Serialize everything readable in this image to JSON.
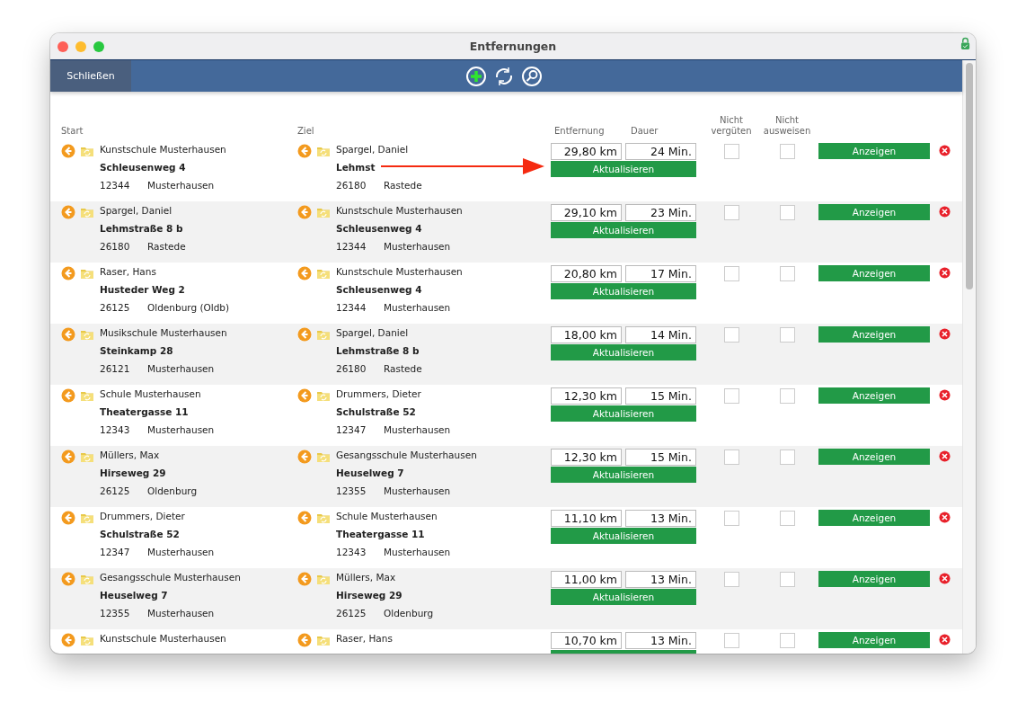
{
  "window": {
    "title": "Entfernungen"
  },
  "toolbar": {
    "close_label": "Schließen"
  },
  "columns": {
    "start": "Start",
    "ziel": "Ziel",
    "distance": "Entfernung",
    "duration": "Dauer",
    "not_paid": "Nicht vergüten",
    "not_shown": "Nicht ausweisen"
  },
  "rows": [
    {
      "start": {
        "name": "Kunstschule Musterhausen",
        "street": "Schleusenweg 4",
        "zip": "12344",
        "city": "Musterhausen"
      },
      "ziel": {
        "name": "Spargel, Daniel",
        "street": "Lehmst",
        "zip": "26180",
        "city": "Rastede"
      },
      "distance": "29,80 km",
      "duration": "24 Min.",
      "update": "Aktualisieren",
      "not_paid": false,
      "not_shown": false,
      "show": "Anzeigen",
      "annotated": true
    },
    {
      "start": {
        "name": "Spargel, Daniel",
        "street": "Lehmstraße 8 b",
        "zip": "26180",
        "city": "Rastede"
      },
      "ziel": {
        "name": "Kunstschule Musterhausen",
        "street": "Schleusenweg 4",
        "zip": "12344",
        "city": "Musterhausen"
      },
      "distance": "29,10 km",
      "duration": "23 Min.",
      "update": "Aktualisieren",
      "not_paid": false,
      "not_shown": false,
      "show": "Anzeigen",
      "annotated": false
    },
    {
      "start": {
        "name": "Raser, Hans",
        "street": "Husteder Weg 2",
        "zip": "26125",
        "city": "Oldenburg (Oldb)"
      },
      "ziel": {
        "name": "Kunstschule Musterhausen",
        "street": "Schleusenweg 4",
        "zip": "12344",
        "city": "Musterhausen"
      },
      "distance": "20,80 km",
      "duration": "17 Min.",
      "update": "Aktualisieren",
      "not_paid": false,
      "not_shown": false,
      "show": "Anzeigen",
      "annotated": false
    },
    {
      "start": {
        "name": "Musikschule Musterhausen",
        "street": "Steinkamp 28",
        "zip": "26121",
        "city": "Musterhausen"
      },
      "ziel": {
        "name": "Spargel, Daniel",
        "street": "Lehmstraße 8 b",
        "zip": "26180",
        "city": "Rastede"
      },
      "distance": "18,00 km",
      "duration": "14 Min.",
      "update": "Aktualisieren",
      "not_paid": false,
      "not_shown": false,
      "show": "Anzeigen",
      "annotated": false
    },
    {
      "start": {
        "name": "Schule Musterhausen",
        "street": "Theatergasse 11",
        "zip": "12343",
        "city": "Musterhausen"
      },
      "ziel": {
        "name": "Drummers, Dieter",
        "street": "Schulstraße 52",
        "zip": "12347",
        "city": "Musterhausen"
      },
      "distance": "12,30 km",
      "duration": "15 Min.",
      "update": "Aktualisieren",
      "not_paid": false,
      "not_shown": false,
      "show": "Anzeigen",
      "annotated": false
    },
    {
      "start": {
        "name": "Müllers, Max",
        "street": "Hirseweg 29",
        "zip": "26125",
        "city": "Oldenburg"
      },
      "ziel": {
        "name": "Gesangsschule Musterhausen",
        "street": "Heuselweg 7",
        "zip": "12355",
        "city": "Musterhausen"
      },
      "distance": "12,30 km",
      "duration": "15 Min.",
      "update": "Aktualisieren",
      "not_paid": false,
      "not_shown": false,
      "show": "Anzeigen",
      "annotated": false
    },
    {
      "start": {
        "name": "Drummers, Dieter",
        "street": "Schulstraße 52",
        "zip": "12347",
        "city": "Musterhausen"
      },
      "ziel": {
        "name": "Schule Musterhausen",
        "street": "Theatergasse 11",
        "zip": "12343",
        "city": "Musterhausen"
      },
      "distance": "11,10 km",
      "duration": "13 Min.",
      "update": "Aktualisieren",
      "not_paid": false,
      "not_shown": false,
      "show": "Anzeigen",
      "annotated": false
    },
    {
      "start": {
        "name": "Gesangsschule Musterhausen",
        "street": "Heuselweg 7",
        "zip": "12355",
        "city": "Musterhausen"
      },
      "ziel": {
        "name": "Müllers, Max",
        "street": "Hirseweg 29",
        "zip": "26125",
        "city": "Oldenburg"
      },
      "distance": "11,00 km",
      "duration": "13 Min.",
      "update": "Aktualisieren",
      "not_paid": false,
      "not_shown": false,
      "show": "Anzeigen",
      "annotated": false
    },
    {
      "start": {
        "name": "Kunstschule Musterhausen"
      },
      "ziel": {
        "name": "Raser, Hans"
      },
      "distance": "10,70 km",
      "duration": "13 Min.",
      "not_paid": false,
      "not_shown": false,
      "show": "Anzeigen",
      "annotated": false
    }
  ]
}
